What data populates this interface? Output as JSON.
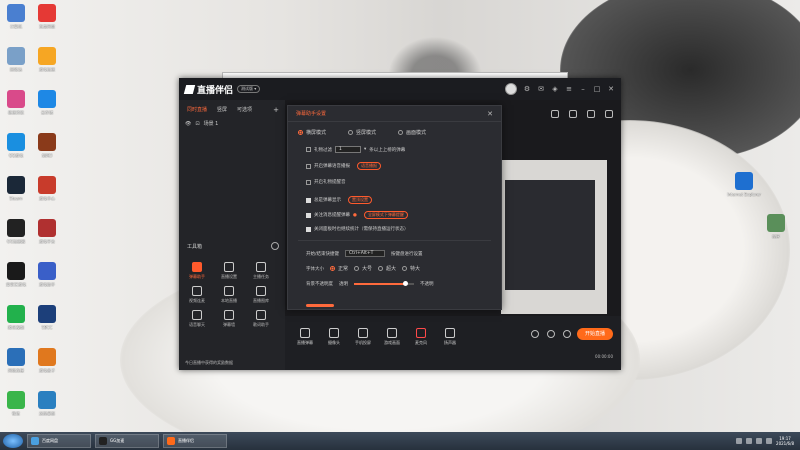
{
  "desktop": {
    "icons_left": [
      {
        "label": "计算机",
        "icon": "computer-icon",
        "color": "#4a7fd0"
      },
      {
        "label": "回收站",
        "icon": "recycle-bin-icon",
        "color": "#7aa0c8"
      },
      {
        "label": "极速浏览",
        "icon": "browser-icon",
        "color": "#d94a8a"
      },
      {
        "label": "QQ游戏",
        "icon": "qq-icon",
        "color": "#1a8fe0"
      },
      {
        "label": "Steam",
        "icon": "steam-icon",
        "color": "#1b2838"
      },
      {
        "label": "GG加速器",
        "icon": "game-icon",
        "color": "#222222"
      },
      {
        "label": "爱奇艺游戏",
        "icon": "game-icon",
        "color": "#1a1a1a"
      },
      {
        "label": "腾讯视频",
        "icon": "video-icon",
        "color": "#22b14c"
      },
      {
        "label": "网络连接",
        "icon": "network-icon",
        "color": "#2b6fb8"
      },
      {
        "label": "微信",
        "icon": "wechat-icon",
        "color": "#3ab54a"
      }
    ],
    "icons_col2": [
      {
        "label": "百度网盘",
        "icon": "money-icon",
        "color": "#e53935"
      },
      {
        "label": "游戏加速",
        "icon": "game-icon",
        "color": "#f6a623"
      },
      {
        "label": "云存储",
        "icon": "cloud-icon",
        "color": "#1e88e5"
      },
      {
        "label": "剑网3",
        "icon": "game-icon",
        "color": "#8a3a1a"
      },
      {
        "label": "游戏中心",
        "icon": "game-icon",
        "color": "#c83b2b"
      },
      {
        "label": "游戏平台",
        "icon": "game-icon",
        "color": "#b03030"
      },
      {
        "label": "游戏助手",
        "icon": "game-icon",
        "color": "#3a5fc8"
      },
      {
        "label": "SBCC",
        "icon": "app-icon",
        "color": "#1c3f7a"
      },
      {
        "label": "游戏盒子",
        "icon": "game-icon",
        "color": "#e0781e"
      },
      {
        "label": "远程桌面",
        "icon": "remote-icon",
        "color": "#2a7fc0"
      }
    ],
    "icons_right": [
      {
        "label": "Internet Explorer",
        "icon": "ie-icon",
        "color": "#1e6fd0"
      },
      {
        "label": "程序",
        "icon": "program-icon",
        "color": "#5a8f5a"
      }
    ]
  },
  "app": {
    "title": "直播伴侣",
    "version": "测试版 ▾",
    "tabs": [
      "同时直播",
      "竖屏",
      "可选项"
    ],
    "active_tab": 0,
    "scene_label": "场景 1",
    "tools_header": "工具箱",
    "tools": [
      {
        "label": "弹幕助手",
        "hot": true
      },
      {
        "label": "直播设置",
        "hot": false
      },
      {
        "label": "主播任务",
        "hot": false
      },
      {
        "label": "视频连麦",
        "hot": false
      },
      {
        "label": "本地直播",
        "hot": false
      },
      {
        "label": "直播图库",
        "hot": false
      },
      {
        "label": "语音聊天",
        "hot": false
      },
      {
        "label": "弹幕墙",
        "hot": false
      },
      {
        "label": "歌词助手",
        "hot": false
      }
    ],
    "bottom_hint": "今日直播中获得的奖励数据",
    "bottom_bar": [
      {
        "label": "直播弹幕",
        "icon": "comment-icon"
      },
      {
        "label": "摄像头",
        "icon": "camera-icon"
      },
      {
        "label": "手机投屏",
        "icon": "phone-icon"
      },
      {
        "label": "游戏画面",
        "icon": "screen-icon"
      },
      {
        "label": "麦克风",
        "icon": "mic-icon"
      },
      {
        "label": "扬声器",
        "icon": "speaker-icon"
      }
    ],
    "start_button": "开始直播",
    "timer": "00:00:00"
  },
  "dialog": {
    "title": "弹幕助手设置",
    "modes": [
      "横屏模式",
      "竖屏模式",
      "画面模式"
    ],
    "active_mode": 0,
    "options": [
      {
        "label": "礼物过滤",
        "checked": false,
        "select": "1",
        "suffix": "条以上上榜的弹幕"
      },
      {
        "label": "开启弹幕语音播报",
        "checked": false,
        "pill": "语音播报"
      },
      {
        "label": "开启礼物提醒音",
        "checked": false
      },
      {
        "label": "总是弹幕显示",
        "checked": true,
        "pill": "置顶设置"
      },
      {
        "label": "关注消息提醒弹幕",
        "checked": true,
        "pill": "全屏模式下弹幕提醒"
      },
      {
        "label": "关闭面板时也继续统计（需保持直播运行状态）",
        "checked": true
      }
    ],
    "hotkey_label": "开始/结束快捷键",
    "hotkey_value": "Ctrl+Alt+T",
    "hotkey_hint": "按键盘进行设置",
    "font_size_label": "字体大小",
    "font_sizes": [
      "正常",
      "大号",
      "超大",
      "特大"
    ],
    "font_size_active": 0,
    "opacity_label": "背景不透明度",
    "opacity_start": "透明",
    "opacity_end": "不透明",
    "opacity_value": 0.85
  },
  "taskbar": {
    "tasks": [
      {
        "label": "百度网盘",
        "color": "#4aa0e0"
      },
      {
        "label": "GG加速",
        "color": "#222222"
      },
      {
        "label": "直播伴侣",
        "color": "#ff6a1a"
      }
    ],
    "time": "19:17",
    "date": "2021/6/8"
  }
}
